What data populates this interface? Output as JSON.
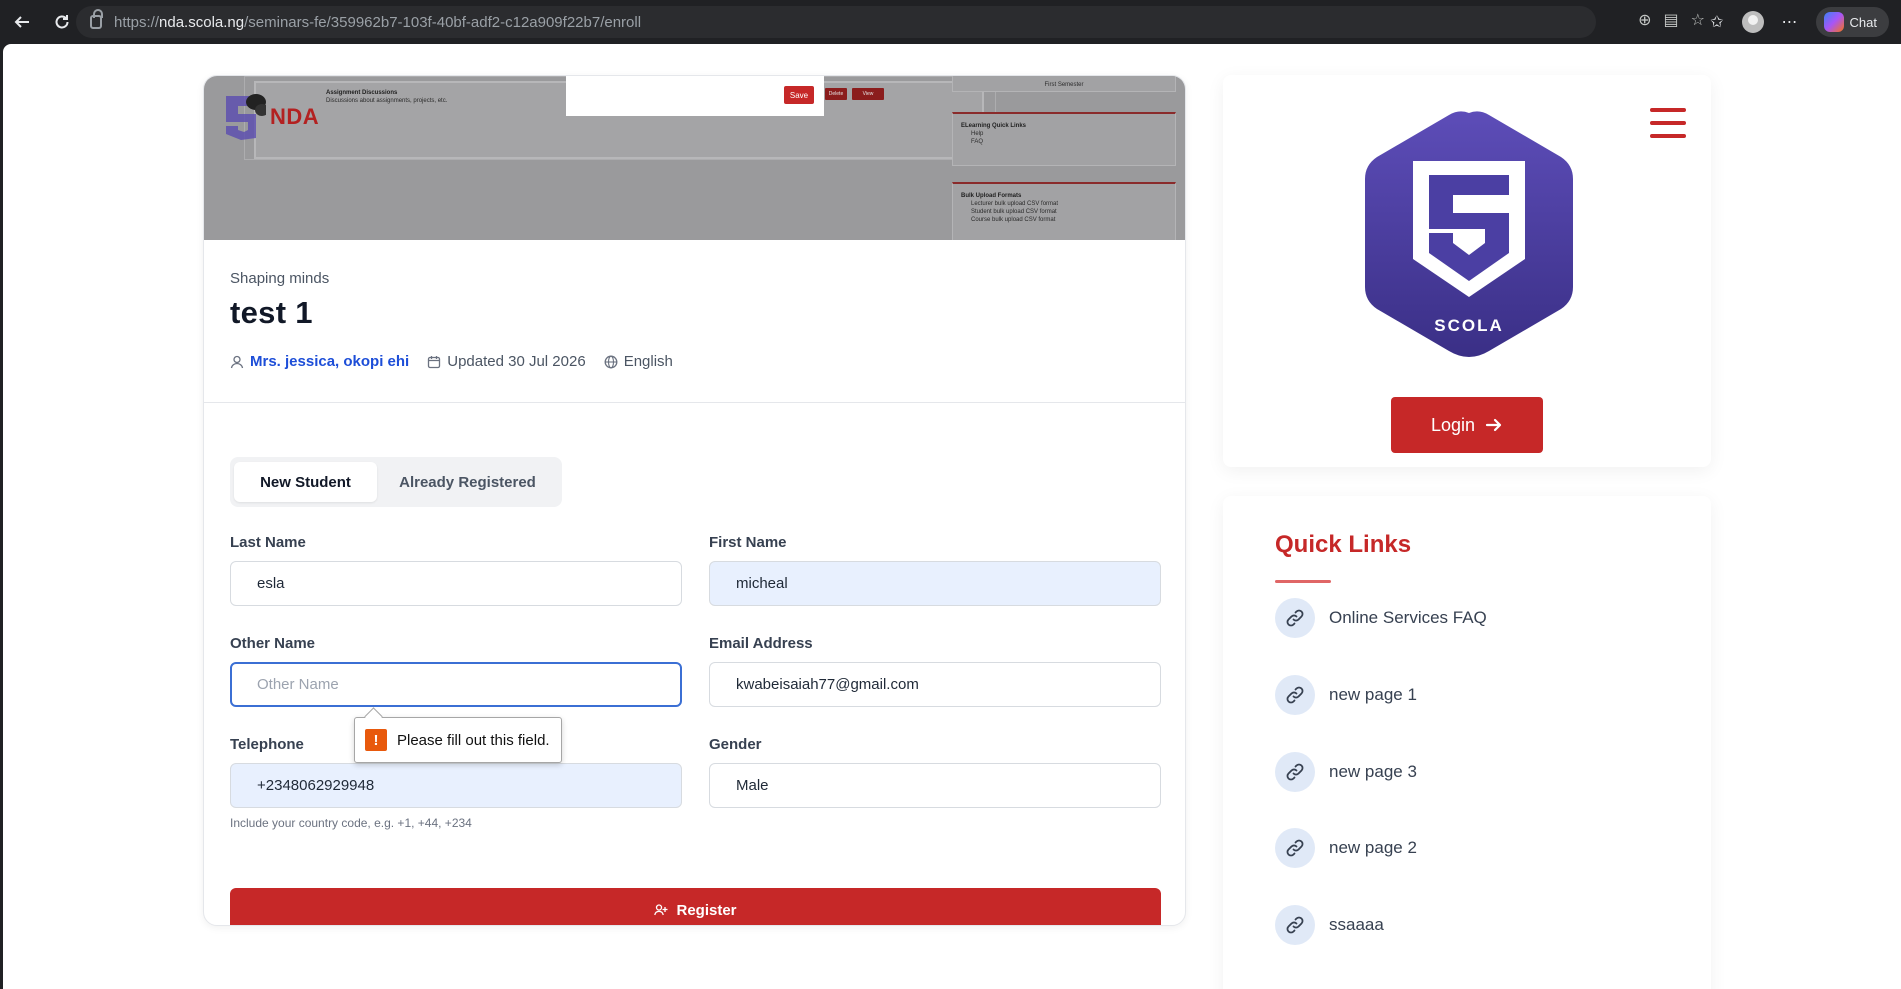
{
  "browser": {
    "url_prefix": "https://",
    "url_host": "nda.scola.ng",
    "url_path": "/seminars-fe/359962b7-103f-40bf-adf2-c12a909f22b7/enroll",
    "chat_label": "Chat"
  },
  "banner": {
    "logo_text": "NDA",
    "panel_title": "Assignment Discussions",
    "panel_desc": "Discussions about assignments, projects, etc.",
    "semester_label": "First Semester",
    "quicklinks_title": "ELearning Quick Links",
    "quicklinks_items": [
      "Help",
      "FAQ"
    ],
    "bulk_title": "Bulk Upload Formats",
    "bulk_items": [
      "Lecturer bulk upload CSV format",
      "Student bulk upload CSV format",
      "Course bulk upload CSV format"
    ],
    "save_label": "Save",
    "mini_btn_1": "Delete",
    "mini_btn_2": "View"
  },
  "course": {
    "eyebrow": "Shaping minds",
    "title": "test 1",
    "author": "Mrs. jessica, okopi ehi",
    "updated": "Updated 30 Jul 2026",
    "language": "English"
  },
  "tabs": {
    "new_student": "New Student",
    "already_registered": "Already Registered"
  },
  "form": {
    "last_name": {
      "label": "Last Name",
      "value": "esla"
    },
    "first_name": {
      "label": "First Name",
      "value": "micheal"
    },
    "other_name": {
      "label": "Other Name",
      "placeholder": "Other Name"
    },
    "email": {
      "label": "Email Address",
      "value": "kwabeisaiah77@gmail.com"
    },
    "telephone": {
      "label": "Telephone",
      "value": "+2348062929948",
      "hint": "Include your country code, e.g. +1, +44, +234"
    },
    "gender": {
      "label": "Gender",
      "value": "Male"
    },
    "validation_message": "Please fill out this field.",
    "register_label": "Register"
  },
  "sidebar": {
    "logo_text": "SCOLA",
    "login_label": "Login",
    "quick_links_title": "Quick Links",
    "links": [
      "Online Services FAQ",
      "new page 1",
      "new page 3",
      "new page 2",
      "ssaaaa"
    ]
  },
  "colors": {
    "brand_red": "#c62828",
    "logo_purple": "#4b3fa3",
    "link_blue": "#1d4ed8"
  }
}
